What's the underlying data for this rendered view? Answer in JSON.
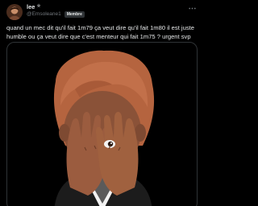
{
  "author": {
    "display_name": "lee",
    "verified_star": "✮",
    "handle": "@Emsoleane1",
    "badge": "Membre",
    "avatar_icon": "profile-photo-icon"
  },
  "menu_icon": "more-options-icon",
  "tweet_text": "quand un mec dit qu'il fait 1m79 ça veut dire qu'il fait 1m80 il est juste humble ou ça veut dire que c'est menteur qui fait 1m75 ? urgent svp",
  "media": {
    "description_icon": "memoji-covering-face-icon"
  },
  "colors": {
    "background": "#000000",
    "text": "#e7e9ea",
    "muted": "#71767b",
    "border": "#2f3336"
  }
}
